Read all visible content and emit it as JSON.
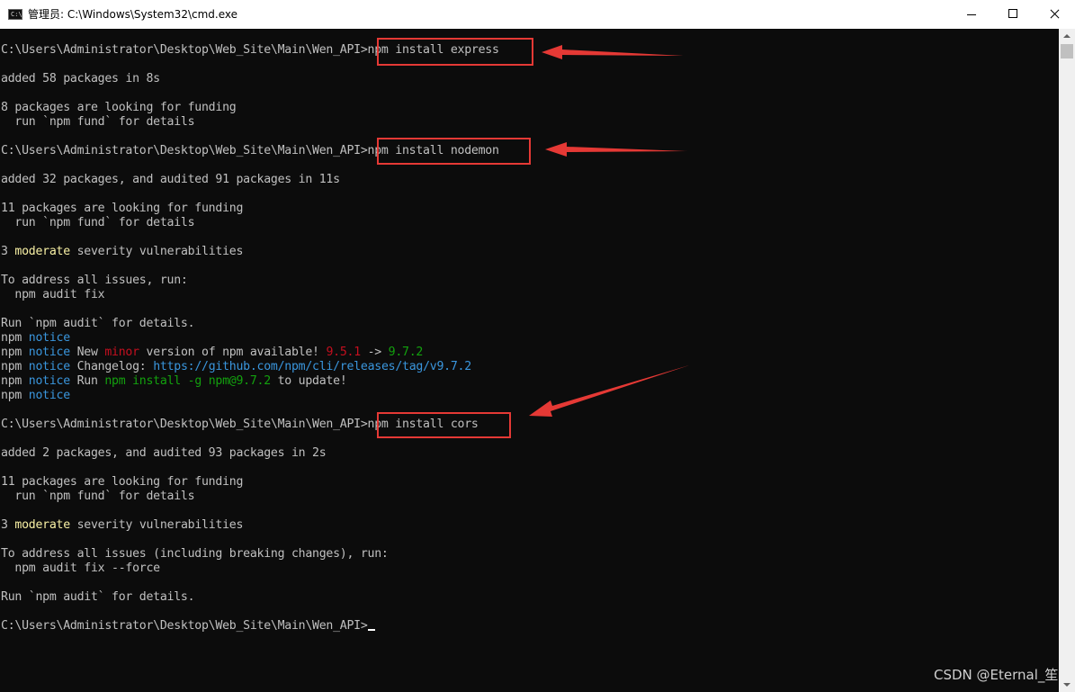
{
  "window": {
    "title": "管理员: C:\\Windows\\System32\\cmd.exe",
    "icon": "cmd-icon",
    "icon_text": "C:\\"
  },
  "console": {
    "lines": [
      {
        "segments": [
          {
            "t": "C:\\Users\\Administrator\\Desktop\\Web_Site\\Main\\Wen_API>npm install express",
            "c": "default"
          }
        ]
      },
      {
        "segments": []
      },
      {
        "segments": [
          {
            "t": "added 58 packages in 8s",
            "c": "default"
          }
        ]
      },
      {
        "segments": []
      },
      {
        "segments": [
          {
            "t": "8 packages are looking for funding",
            "c": "default"
          }
        ]
      },
      {
        "segments": [
          {
            "t": "  run `npm fund` for details",
            "c": "default"
          }
        ]
      },
      {
        "segments": []
      },
      {
        "segments": [
          {
            "t": "C:\\Users\\Administrator\\Desktop\\Web_Site\\Main\\Wen_API>npm install nodemon",
            "c": "default"
          }
        ]
      },
      {
        "segments": []
      },
      {
        "segments": [
          {
            "t": "added 32 packages, and audited 91 packages in 11s",
            "c": "default"
          }
        ]
      },
      {
        "segments": []
      },
      {
        "segments": [
          {
            "t": "11 packages are looking for funding",
            "c": "default"
          }
        ]
      },
      {
        "segments": [
          {
            "t": "  run `npm fund` for details",
            "c": "default"
          }
        ]
      },
      {
        "segments": []
      },
      {
        "segments": [
          {
            "t": "3 ",
            "c": "default"
          },
          {
            "t": "moderate",
            "c": "yellow"
          },
          {
            "t": " severity vulnerabilities",
            "c": "default"
          }
        ]
      },
      {
        "segments": []
      },
      {
        "segments": [
          {
            "t": "To address all issues, run:",
            "c": "default"
          }
        ]
      },
      {
        "segments": [
          {
            "t": "  npm audit fix",
            "c": "default"
          }
        ]
      },
      {
        "segments": []
      },
      {
        "segments": [
          {
            "t": "Run `npm audit` for details.",
            "c": "default"
          }
        ]
      },
      {
        "segments": [
          {
            "t": "npm ",
            "c": "default"
          },
          {
            "t": "notice",
            "c": "cyan"
          }
        ]
      },
      {
        "segments": [
          {
            "t": "npm ",
            "c": "default"
          },
          {
            "t": "notice",
            "c": "cyan"
          },
          {
            "t": " New ",
            "c": "default"
          },
          {
            "t": "minor",
            "c": "red"
          },
          {
            "t": " version of npm available! ",
            "c": "default"
          },
          {
            "t": "9.5.1",
            "c": "red"
          },
          {
            "t": " -> ",
            "c": "default"
          },
          {
            "t": "9.7.2",
            "c": "green"
          }
        ]
      },
      {
        "segments": [
          {
            "t": "npm ",
            "c": "default"
          },
          {
            "t": "notice",
            "c": "cyan"
          },
          {
            "t": " Changelog: ",
            "c": "default"
          },
          {
            "t": "https://github.com/npm/cli/releases/tag/v9.7.2",
            "c": "cyan"
          }
        ]
      },
      {
        "segments": [
          {
            "t": "npm ",
            "c": "default"
          },
          {
            "t": "notice",
            "c": "cyan"
          },
          {
            "t": " Run ",
            "c": "default"
          },
          {
            "t": "npm install -g npm@9.7.2",
            "c": "green"
          },
          {
            "t": " to update!",
            "c": "default"
          }
        ]
      },
      {
        "segments": [
          {
            "t": "npm ",
            "c": "default"
          },
          {
            "t": "notice",
            "c": "cyan"
          }
        ]
      },
      {
        "segments": []
      },
      {
        "segments": [
          {
            "t": "C:\\Users\\Administrator\\Desktop\\Web_Site\\Main\\Wen_API>npm install cors",
            "c": "default"
          }
        ]
      },
      {
        "segments": []
      },
      {
        "segments": [
          {
            "t": "added 2 packages, and audited 93 packages in 2s",
            "c": "default"
          }
        ]
      },
      {
        "segments": []
      },
      {
        "segments": [
          {
            "t": "11 packages are looking for funding",
            "c": "default"
          }
        ]
      },
      {
        "segments": [
          {
            "t": "  run `npm fund` for details",
            "c": "default"
          }
        ]
      },
      {
        "segments": []
      },
      {
        "segments": [
          {
            "t": "3 ",
            "c": "default"
          },
          {
            "t": "moderate",
            "c": "yellow"
          },
          {
            "t": " severity vulnerabilities",
            "c": "default"
          }
        ]
      },
      {
        "segments": []
      },
      {
        "segments": [
          {
            "t": "To address all issues (including breaking changes), run:",
            "c": "default"
          }
        ]
      },
      {
        "segments": [
          {
            "t": "  npm audit fix --force",
            "c": "default"
          }
        ]
      },
      {
        "segments": []
      },
      {
        "segments": [
          {
            "t": "Run `npm audit` for details.",
            "c": "default"
          }
        ]
      },
      {
        "segments": []
      },
      {
        "segments": [
          {
            "t": "C:\\Users\\Administrator\\Desktop\\Web_Site\\Main\\Wen_API>",
            "c": "default"
          }
        ],
        "cursor": true
      }
    ]
  },
  "colors": {
    "default": "#c0c0c0",
    "yellow": "#f9f1a5",
    "cyan": "#3a96dd",
    "red": "#c50f1f",
    "green": "#13a10e",
    "annotation": "#e53935",
    "background": "#0c0c0c"
  },
  "annotations": {
    "boxed_commands": [
      "npm install express",
      "npm install nodemon",
      "npm install cors"
    ]
  },
  "watermark": "CSDN @Eternal_笙"
}
